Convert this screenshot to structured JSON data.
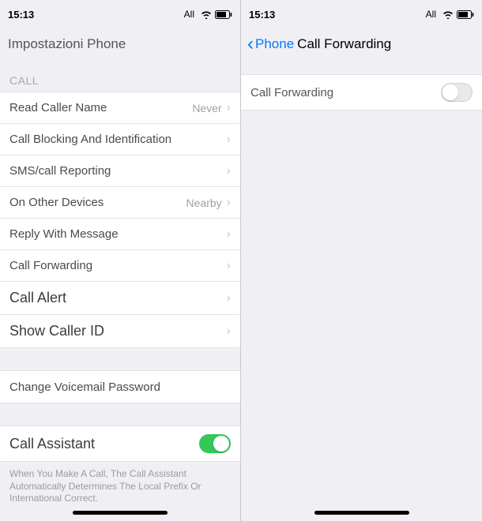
{
  "status": {
    "time": "15:13",
    "carrier": "All"
  },
  "left": {
    "nav_back": "Impostazioni",
    "nav_title": "Phone",
    "section_call": "CALL",
    "rows": {
      "read_caller": {
        "label": "Read Caller Name",
        "value": "Never"
      },
      "blocking": {
        "label": "Call Blocking And Identification"
      },
      "sms_report": {
        "label": "SMS/call Reporting"
      },
      "other_devices": {
        "label": "On Other Devices",
        "value": "Nearby"
      },
      "reply_msg": {
        "label": "Reply With Message"
      },
      "forwarding": {
        "label": "Call Forwarding"
      },
      "call_alert": {
        "label": "Call Alert"
      },
      "caller_id": {
        "label": "Show Caller ID"
      },
      "voicemail_pw": {
        "label": "Change Voicemail Password"
      },
      "call_assistant": {
        "label": "Call Assistant"
      }
    },
    "footer": "When You Make A Call, The Call Assistant Automatically Determines The Local Prefix Or International Correct."
  },
  "right": {
    "nav_back": "Phone",
    "nav_title": "Call Forwarding",
    "row": {
      "label": "Call Forwarding"
    }
  }
}
